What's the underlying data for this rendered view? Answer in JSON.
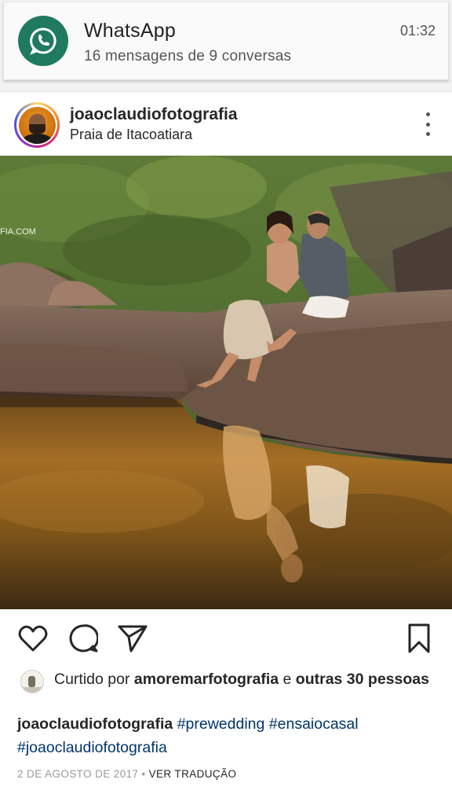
{
  "notification": {
    "app_name": "WhatsApp",
    "summary": "16 mensagens de 9 conversas",
    "time": "01:32",
    "icon": "whatsapp-icon",
    "accent": "#1f7a5f"
  },
  "post": {
    "username": "joaoclaudiofotografia",
    "location": "Praia de Itacoatiara",
    "photo_watermark": "FIA.COM",
    "actions": {
      "like_icon": "heart-icon",
      "comment_icon": "comment-icon",
      "share_icon": "send-icon",
      "save_icon": "bookmark-icon"
    },
    "likes": {
      "prefix": "Curtido por ",
      "first_user": "amoremarfotografia",
      "connector": " e ",
      "others": "outras 30 pessoas"
    },
    "caption": {
      "user": "joaoclaudiofotografia",
      "hashtags": [
        "#prewedding",
        "#ensaiocasal",
        "#joaoclaudiofotografia"
      ]
    },
    "date": "2 DE AGOSTO DE 2017",
    "separator": "•",
    "translate": "VER TRADUÇÃO",
    "hashtag_color": "#003569"
  }
}
